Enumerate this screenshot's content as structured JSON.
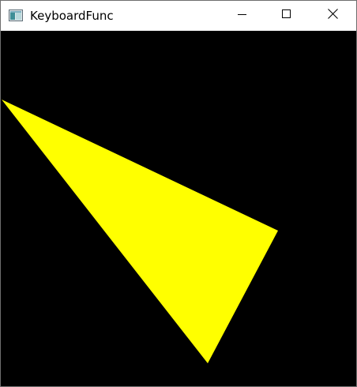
{
  "window": {
    "title": "KeyboardFunc"
  },
  "title_bar": {
    "app_icon": "application-window-icon",
    "buttons": [
      {
        "name": "minimize",
        "icon": "minimize-icon"
      },
      {
        "name": "maximize",
        "icon": "maximize-icon"
      },
      {
        "name": "close",
        "icon": "close-icon"
      }
    ]
  },
  "canvas": {
    "background_color": "#000000",
    "shape": "triangle",
    "fill_color": "#ffff00"
  }
}
